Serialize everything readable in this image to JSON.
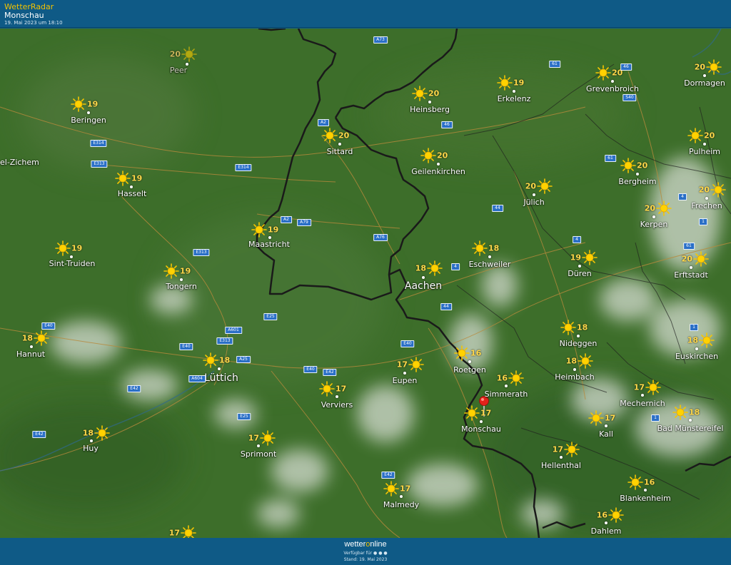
{
  "header": {
    "brand": "WetterRadar",
    "location": "Monschau",
    "timestamp": "19. Mai 2023 um 18:10"
  },
  "footer": {
    "logo_part1": "wetter",
    "logo_o": "o",
    "logo_part2": "nline",
    "availability": "Verfügbar für ● ● ●",
    "status": "Stand: 19. Mai 2023"
  },
  "map": {
    "weather_icon": "sun-icon",
    "marker_icon": "location-pin-icon",
    "marker_color": "#e2231a",
    "colors": {
      "terrain": "#3d6e2a",
      "border": "#1a1a1a",
      "roads": "#b88a3c",
      "temperature": "#ffd84a",
      "road_sign": "#2a6fc7"
    },
    "cities": [
      {
        "name": "Peer",
        "temp": "20",
        "faded": true
      },
      {
        "name": "Beringen",
        "temp": "19"
      },
      {
        "name": "el-Zichem",
        "temp": ""
      },
      {
        "name": "Hasselt",
        "temp": "19"
      },
      {
        "name": "Sint-Truiden",
        "temp": "19"
      },
      {
        "name": "Tongern",
        "temp": "19"
      },
      {
        "name": "Hannut",
        "temp": "18"
      },
      {
        "name": "Huy",
        "temp": "18"
      },
      {
        "name": "Lüttich",
        "temp": "18",
        "big": true
      },
      {
        "name": "Sprimont",
        "temp": "17"
      },
      {
        "name": "Maastricht",
        "temp": "19"
      },
      {
        "name": "Sittard",
        "temp": "20"
      },
      {
        "name": "Heinsberg",
        "temp": "20"
      },
      {
        "name": "Geilenkirchen",
        "temp": "20"
      },
      {
        "name": "Erkelenz",
        "temp": "19"
      },
      {
        "name": "Grevenbroich",
        "temp": "20"
      },
      {
        "name": "Dormagen",
        "temp": "20"
      },
      {
        "name": "Pulheim",
        "temp": "20"
      },
      {
        "name": "Bergheim",
        "temp": "20"
      },
      {
        "name": "Frechen",
        "temp": "20"
      },
      {
        "name": "Kerpen",
        "temp": "20"
      },
      {
        "name": "Erftstadt",
        "temp": "20"
      },
      {
        "name": "Jülich",
        "temp": "20"
      },
      {
        "name": "Düren",
        "temp": "19"
      },
      {
        "name": "Eschweiler",
        "temp": "18"
      },
      {
        "name": "Aachen",
        "temp": "18",
        "big": true
      },
      {
        "name": "Nideggen",
        "temp": "18"
      },
      {
        "name": "Euskirchen",
        "temp": "18"
      },
      {
        "name": "Heimbach",
        "temp": "18"
      },
      {
        "name": "Roetgen",
        "temp": "16"
      },
      {
        "name": "Simmerath",
        "temp": "16"
      },
      {
        "name": "Monschau",
        "temp": "17"
      },
      {
        "name": "Eupen",
        "temp": "17"
      },
      {
        "name": "Verviers",
        "temp": "17"
      },
      {
        "name": "Mechernich",
        "temp": "17"
      },
      {
        "name": "Bad Münstereifel",
        "temp": "18"
      },
      {
        "name": "Kall",
        "temp": "17"
      },
      {
        "name": "Hellenthal",
        "temp": "17"
      },
      {
        "name": "Blankenheim",
        "temp": "16"
      },
      {
        "name": "Dahlem",
        "temp": "16"
      },
      {
        "name": "Malmedy",
        "temp": "17"
      },
      {
        "name": "",
        "temp": "17"
      }
    ],
    "road_signs": [
      "A73",
      "61",
      "46",
      "A2",
      "46",
      "E314",
      "E313",
      "E314",
      "61",
      "A2",
      "A79",
      "A76",
      "44",
      "4",
      "E313",
      "4",
      "1",
      "61",
      "4",
      "44",
      "1",
      "E40",
      "A601",
      "E25",
      "E40",
      "E313",
      "A25",
      "E40",
      "E40",
      "E42",
      "A604",
      "E42",
      "E25",
      "E42",
      "E42",
      "1",
      "S40"
    ]
  }
}
